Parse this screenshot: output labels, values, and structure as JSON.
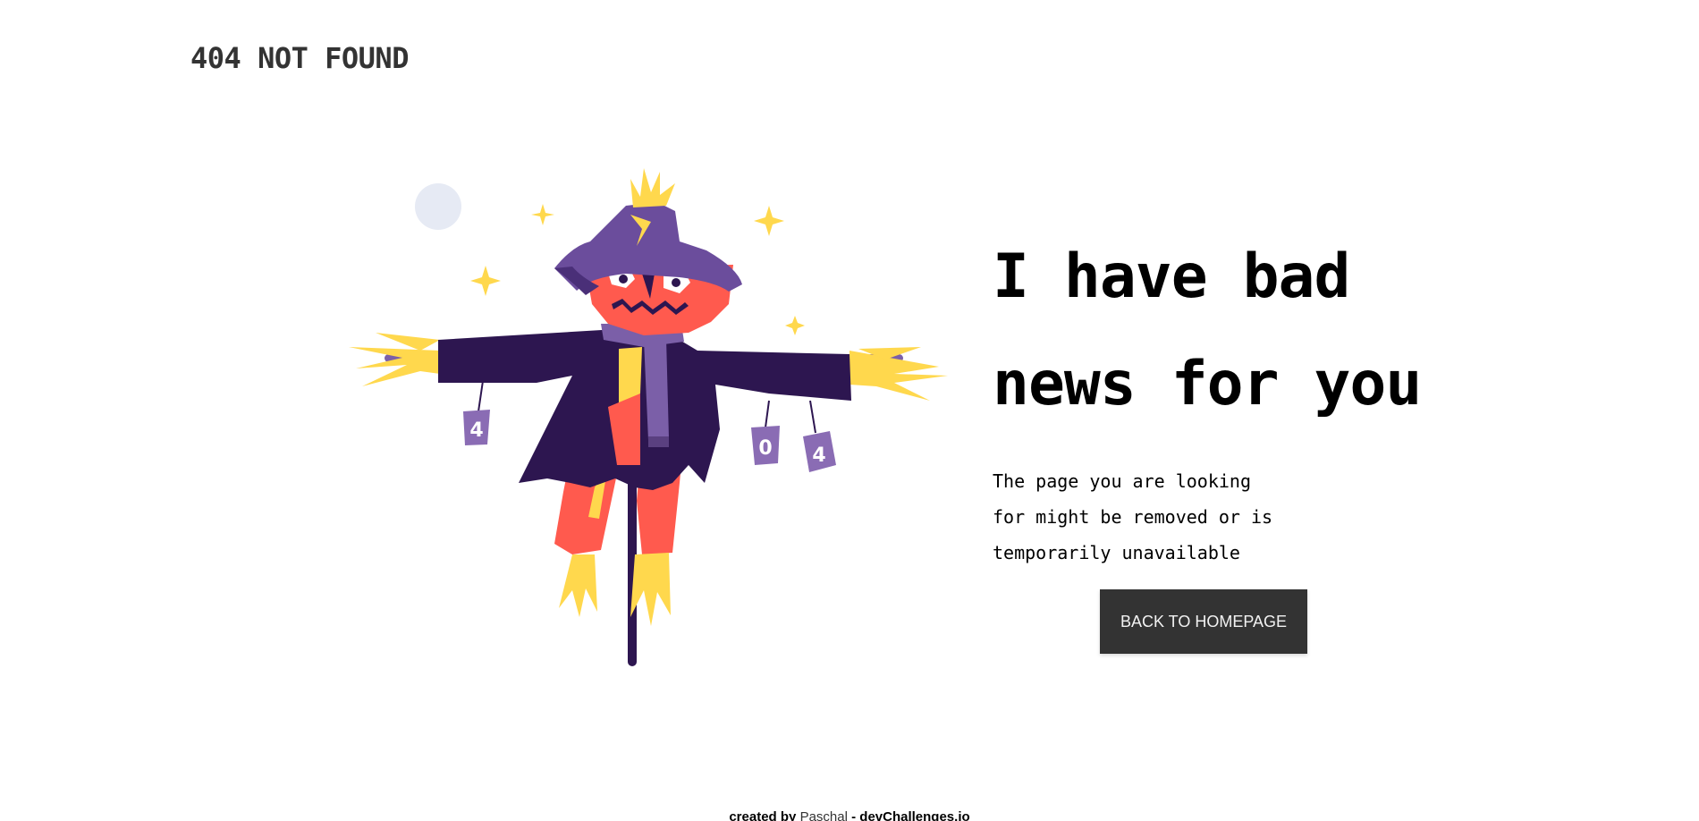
{
  "header": {
    "title": "404 NOT FOUND"
  },
  "illustration": {
    "can_labels": [
      "4",
      "0",
      "4"
    ],
    "colors": {
      "hat": "#6b4d9c",
      "coat": "#2d1650",
      "face": "#ff5a4e",
      "straw": "#ffd84d",
      "scarf": "#7b5fa8",
      "moon": "#e6eaf4"
    }
  },
  "main": {
    "headline_line1": "I have bad",
    "headline_line2": "news for you",
    "message_line1": "The page you are looking",
    "message_line2": "for might be removed or is",
    "message_line3": "temporarily unavailable",
    "button_label": "BACK TO HOMEPAGE"
  },
  "footer": {
    "prefix": "created by",
    "author": "Paschal",
    "separator": "-",
    "site": "devChallenges.io"
  }
}
